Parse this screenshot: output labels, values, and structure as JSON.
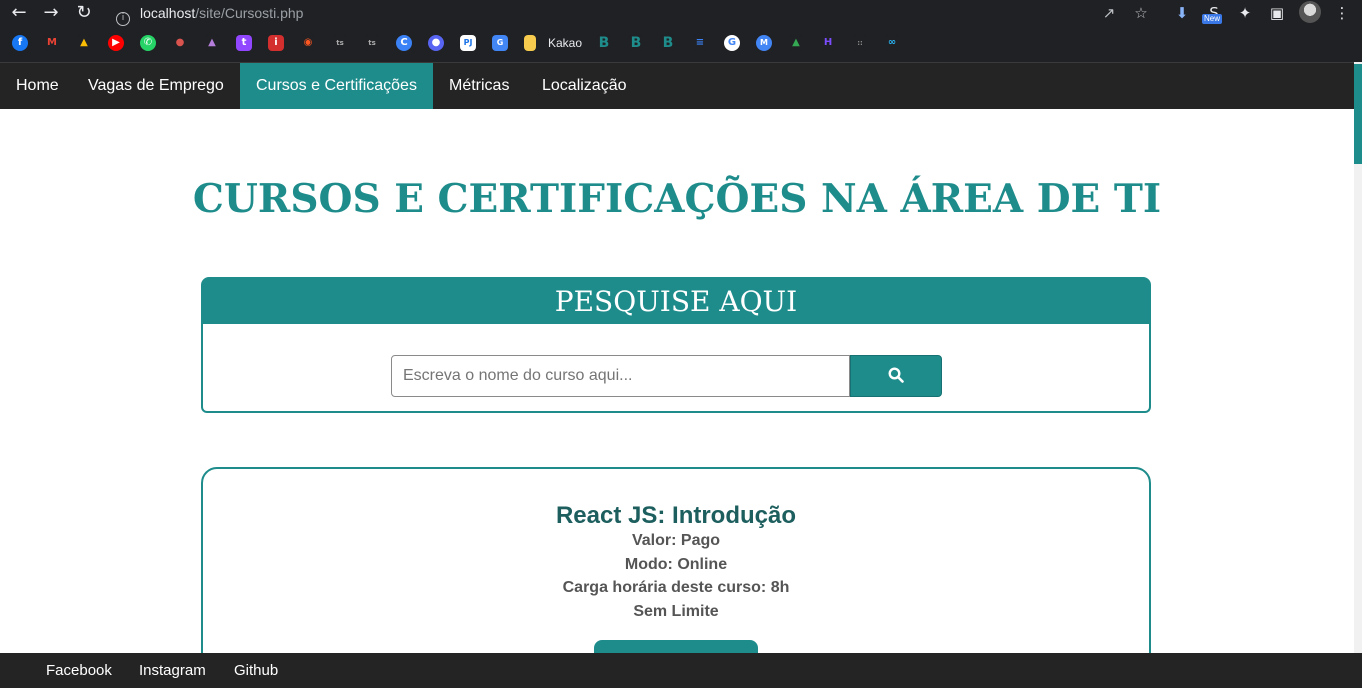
{
  "browser": {
    "url_host": "localhost",
    "url_path": "/site/Cursosti.php",
    "new_badge": "New",
    "bookmark_label": "Kakao"
  },
  "nav": {
    "items": [
      {
        "label": "Home",
        "active": false
      },
      {
        "label": "Vagas de Emprego",
        "active": false
      },
      {
        "label": "Cursos e Certificações",
        "active": true
      },
      {
        "label": "Métricas",
        "active": false
      },
      {
        "label": "Localização",
        "active": false
      }
    ]
  },
  "page": {
    "title": "CURSOS E CERTIFICAÇÕES NA ÁREA DE TI"
  },
  "search": {
    "heading": "PESQUISE AQUI",
    "placeholder": "Escreva o nome do curso aqui...",
    "value": "",
    "button_icon": "search-icon"
  },
  "course": {
    "title": "React JS: Introdução",
    "valor": "Valor: Pago",
    "modo": "Modo: Online",
    "carga": "Carga horária deste curso: 8h",
    "limite": "Sem Limite"
  },
  "footer": {
    "links": [
      "Facebook",
      "Instagram",
      "Github"
    ]
  },
  "colors": {
    "accent": "#1f8c8c",
    "nav_bg": "#242424",
    "title_dark": "#1d5e5e"
  }
}
